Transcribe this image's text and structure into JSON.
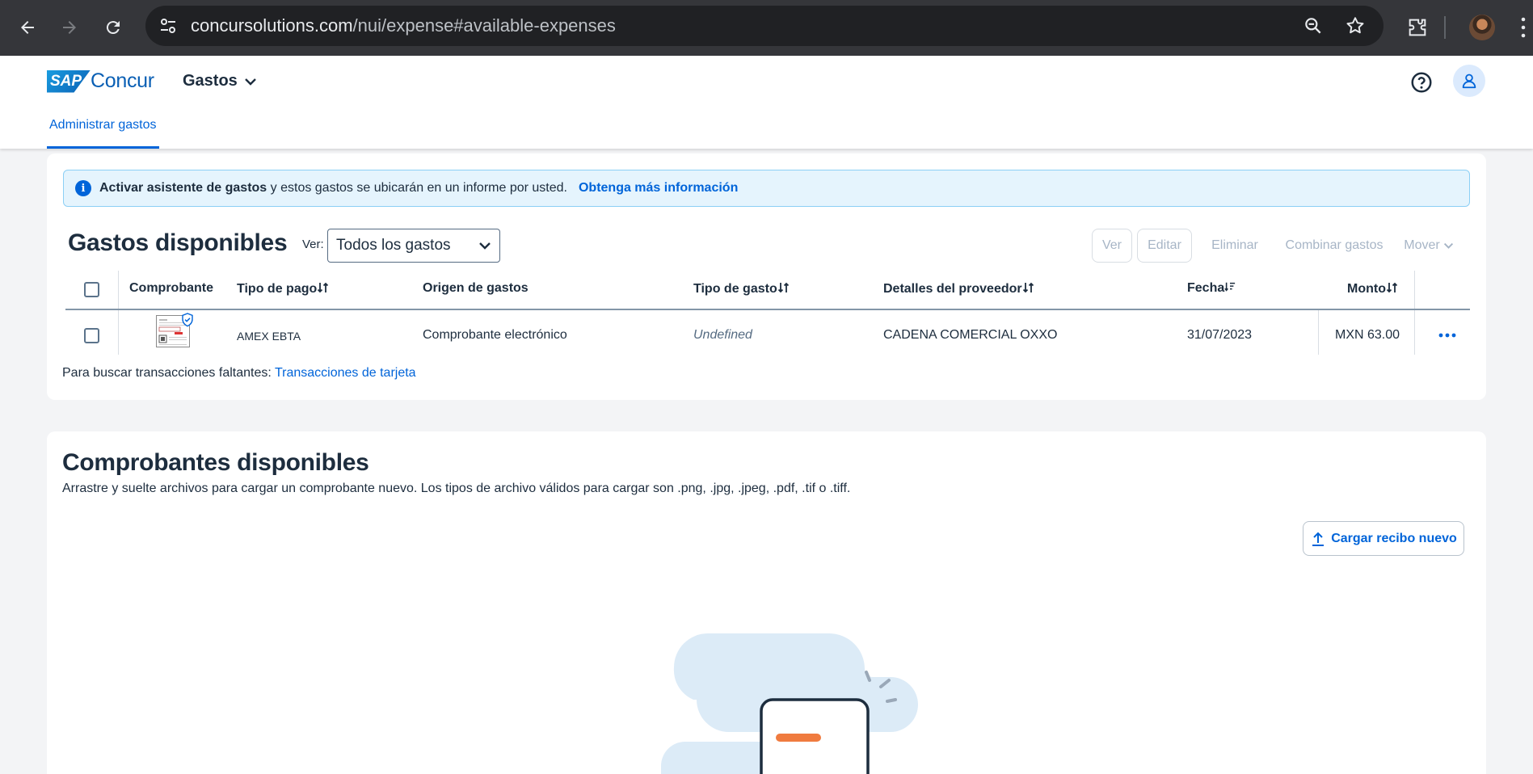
{
  "browser": {
    "url_host": "concursolutions.com",
    "url_path": "/nui/expense#available-expenses"
  },
  "header": {
    "logo_sap": "SAP",
    "logo_concur": "Concur",
    "module": "Gastos",
    "active_tab": "Administrar gastos"
  },
  "banner": {
    "bold_text": "Activar asistente de gastos",
    "text": " y estos gastos se ubicarán en un informe por usted.",
    "link": "Obtenga más información"
  },
  "expenses": {
    "title": "Gastos disponibles",
    "view_label": "Ver:",
    "view_value": "Todos los gastos",
    "actions": [
      "Ver",
      "Editar",
      "Eliminar",
      "Combinar gastos",
      "Mover"
    ],
    "columns": {
      "receipt": "Comprobante",
      "payment_type": "Tipo de pago",
      "origin": "Origen de gastos",
      "expense_type": "Tipo de gasto",
      "vendor": "Detalles del proveedor",
      "date": "Fecha",
      "amount": "Monto"
    },
    "rows": [
      {
        "payment_type": "AMEX EBTA",
        "origin": "Comprobante electrónico",
        "expense_type": "Undefined",
        "vendor": "CADENA COMERCIAL OXXO",
        "date": "31/07/2023",
        "amount": "MXN 63.00"
      }
    ],
    "hint_text": "Para buscar transacciones faltantes: ",
    "hint_link": "Transacciones de tarjeta"
  },
  "receipts": {
    "title": "Comprobantes disponibles",
    "description": "Arrastre y suelte archivos para cargar un comprobante nuevo. Los tipos de archivo válidos para cargar son .png, .jpg, .jpeg, .pdf, .tif o .tiff.",
    "upload_label": "Cargar recibo nuevo"
  },
  "colors": {
    "accent": "#0064d9",
    "disabled": "#a7b5c6",
    "banner_bg": "#e5f4fd",
    "illustration_cloud": "#dcebf7",
    "illustration_accent": "#f07b3f"
  }
}
